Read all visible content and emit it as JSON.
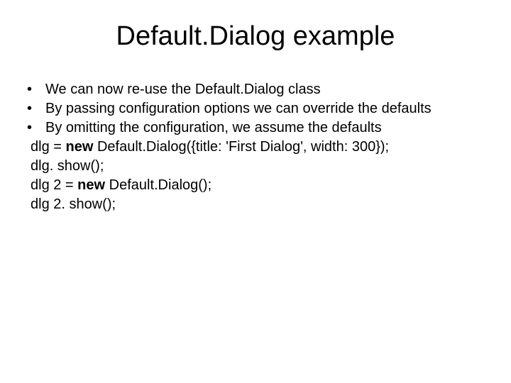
{
  "slide": {
    "title": "Default.Dialog example",
    "bullets": [
      "We can now re-use the Default.Dialog class",
      "By passing configuration options we can override the defaults",
      "By omitting the configuration, we assume the defaults"
    ],
    "code": {
      "line1_a": "dlg = ",
      "line1_b": "new",
      "line1_c": " Default.Dialog({title: 'First Dialog', width: 300});",
      "line2": "dlg. show();",
      "line3_a": "dlg 2 = ",
      "line3_b": "new",
      "line3_c": " Default.Dialog();",
      "line4": "dlg 2. show();"
    },
    "bullet_char": "•"
  }
}
